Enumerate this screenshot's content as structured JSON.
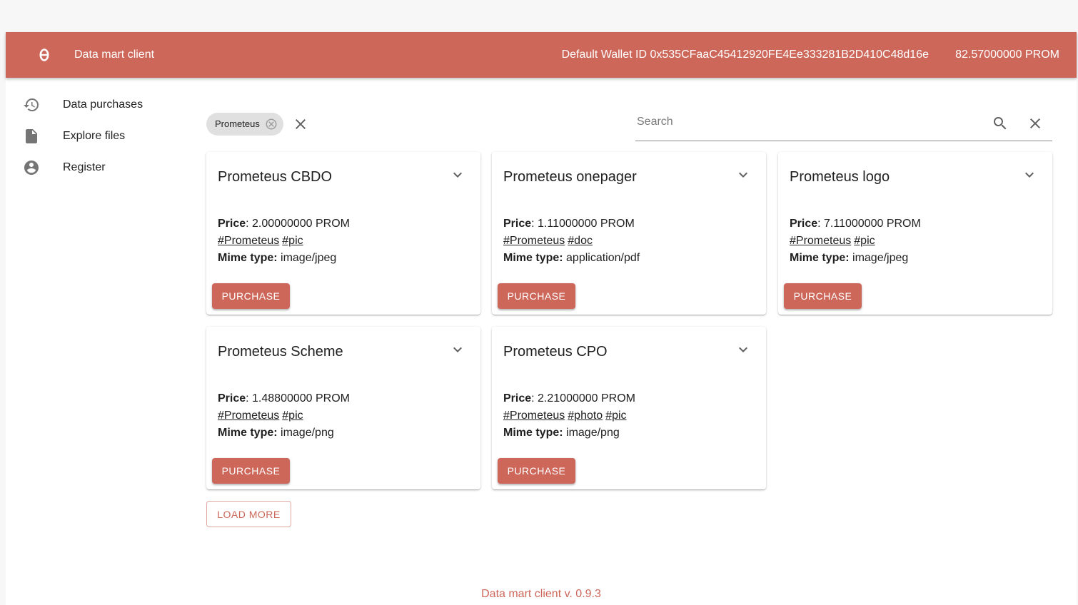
{
  "header": {
    "logo_icon": "theta-logo-icon",
    "title": "Data mart client",
    "wallet_label": "Default Wallet ID 0x535CFaaC45412920FE4Ee333281B2D410C48d16e",
    "balance": "82.57000000 PROM",
    "color": "#cd675a"
  },
  "sidebar": {
    "items": [
      {
        "label": "Data purchases",
        "icon": "history-icon"
      },
      {
        "label": "Explore files",
        "icon": "file-icon"
      },
      {
        "label": "Register",
        "icon": "account-circle-icon"
      }
    ]
  },
  "filter": {
    "chip_label": "Prometeus"
  },
  "search": {
    "placeholder": "Search",
    "value": ""
  },
  "labels": {
    "price": "Price",
    "mime": "Mime type:",
    "purchase": "PURCHASE"
  },
  "cards": [
    {
      "title": "Prometeus CBDO",
      "price": ": 2.00000000 PROM",
      "tags": [
        "#Prometeus",
        "#pic"
      ],
      "mime": " image/jpeg"
    },
    {
      "title": "Prometeus onepager",
      "price": ": 1.11000000 PROM",
      "tags": [
        "#Prometeus",
        "#doc"
      ],
      "mime": " application/pdf"
    },
    {
      "title": "Prometeus logo",
      "price": ": 7.11000000 PROM",
      "tags": [
        "#Prometeus",
        "#pic"
      ],
      "mime": " image/jpeg"
    },
    {
      "title": "Prometeus Scheme",
      "price": ": 1.48800000 PROM",
      "tags": [
        "#Prometeus",
        "#pic"
      ],
      "mime": " image/png"
    },
    {
      "title": "Prometeus CPO",
      "price": ": 2.21000000 PROM",
      "tags": [
        "#Prometeus",
        "#photo",
        "#pic"
      ],
      "mime": " image/png"
    }
  ],
  "load_more": "LOAD MORE",
  "footer": "Data mart client v. 0.9.3"
}
